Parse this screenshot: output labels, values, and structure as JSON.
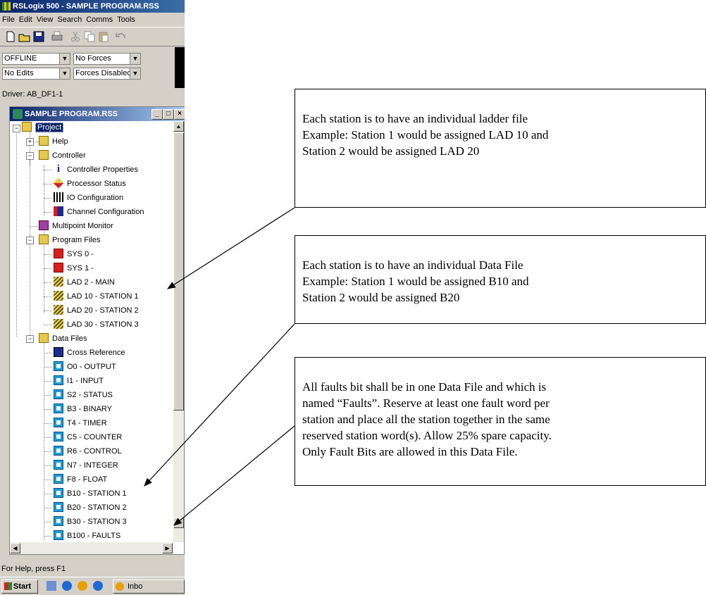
{
  "window": {
    "title": "RSLogix 500 - SAMPLE PROGRAM.RSS"
  },
  "menu": [
    "File",
    "Edit",
    "View",
    "Search",
    "Comms",
    "Tools"
  ],
  "toolbar_icons": [
    "new-icon",
    "open-icon",
    "save-icon",
    "print-icon",
    "cut-icon",
    "copy-icon",
    "paste-icon",
    "undo-icon"
  ],
  "status": {
    "mode": "OFFLINE",
    "forces": "No Forces",
    "edits": "No Edits",
    "forces_enabled": "Forces Disabled",
    "driver": "Driver: AB_DF1-1"
  },
  "project_window": {
    "title": "SAMPLE PROGRAM.RSS"
  },
  "tree": {
    "project": "Project",
    "help": "Help",
    "controller": "Controller",
    "controller_items": [
      "Controller Properties",
      "Processor Status",
      "IO Configuration",
      "Channel Configuration"
    ],
    "multipoint": "Multipoint Monitor",
    "program_files": "Program Files",
    "programs": [
      "SYS 0 -",
      "SYS 1 -",
      "LAD 2 - MAIN",
      "LAD 10 - STATION 1",
      "LAD 20 - STATION 2",
      "LAD 30 - STATION 3"
    ],
    "data_files": "Data Files",
    "cross_reference": "Cross Reference",
    "data": [
      "O0 - OUTPUT",
      "I1 - INPUT",
      "S2 - STATUS",
      "B3 - BINARY",
      "T4 - TIMER",
      "C5 - COUNTER",
      "R6 - CONTROL",
      "N7 - INTEGER",
      "F8 - FLOAT",
      "B10 - STATION 1",
      "B20 - STATION 2",
      "B30 - STATION 3",
      "B100 - FAULTS"
    ]
  },
  "statusbar": "For Help, press F1",
  "taskbar": {
    "start": "Start",
    "item": "Inbo"
  },
  "callouts": [
    {
      "lines": [
        "Each station is to have an individual ladder file",
        "Example: Station 1 would be assigned LAD 10 and",
        "Station 2 would be assigned LAD 20"
      ]
    },
    {
      "lines": [
        "Each station is to have an individual Data File",
        "Example: Station 1 would be assigned B10 and",
        "Station 2 would be assigned B20"
      ]
    },
    {
      "lines": [
        "All faults bit shall be in one Data File and which is",
        "named “Faults”.  Reserve at least one fault word per",
        "station and place all the station together in the same",
        "reserved station word(s).  Allow 25% spare capacity.",
        "Only Fault Bits are allowed in this Data File."
      ]
    }
  ]
}
